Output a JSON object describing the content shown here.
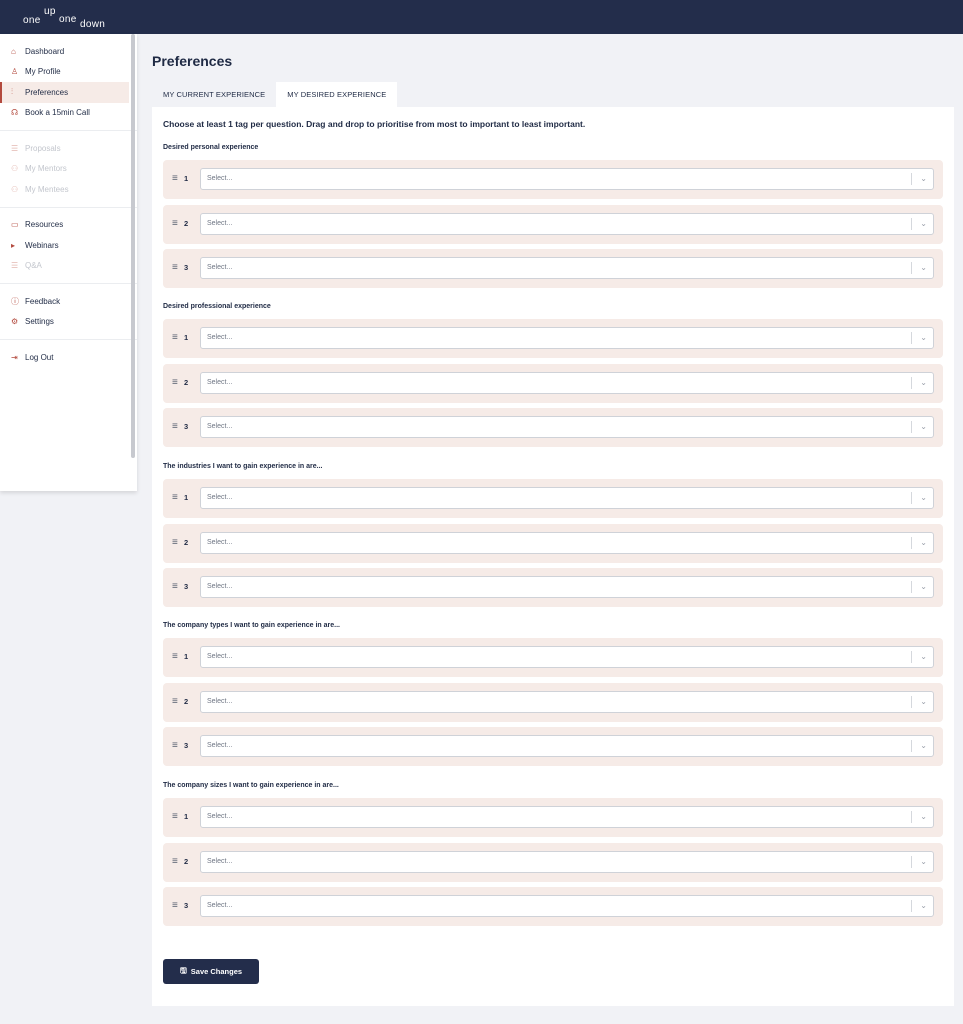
{
  "brand": {
    "w1": "one",
    "w2": "up",
    "w3": "one",
    "w4": "down"
  },
  "sidebar": {
    "groups": [
      [
        {
          "label": "Dashboard",
          "icon": "⌂",
          "state": "normal"
        },
        {
          "label": "My Profile",
          "icon": "♙",
          "state": "normal"
        },
        {
          "label": "Preferences",
          "icon": "⫶",
          "state": "active"
        },
        {
          "label": "Book a 15min Call",
          "icon": "☊",
          "state": "normal"
        }
      ],
      [
        {
          "label": "Proposals",
          "icon": "☰",
          "state": "disabled"
        },
        {
          "label": "My Mentors",
          "icon": "⚇",
          "state": "disabled"
        },
        {
          "label": "My Mentees",
          "icon": "⚇",
          "state": "disabled"
        }
      ],
      [
        {
          "label": "Resources",
          "icon": "▭",
          "state": "normal"
        },
        {
          "label": "Webinars",
          "icon": "▸",
          "state": "normal"
        },
        {
          "label": "Q&A",
          "icon": "☰",
          "state": "disabled"
        }
      ],
      [
        {
          "label": "Feedback",
          "icon": "ⓘ",
          "state": "normal"
        },
        {
          "label": "Settings",
          "icon": "⚙",
          "state": "normal"
        }
      ],
      [
        {
          "label": "Log Out",
          "icon": "⇥",
          "state": "normal"
        }
      ]
    ]
  },
  "main": {
    "title": "Preferences",
    "tabs": [
      {
        "label": "MY CURRENT EXPERIENCE",
        "active": false
      },
      {
        "label": "MY DESIRED EXPERIENCE",
        "active": true
      }
    ],
    "intro": "Choose at least 1 tag per question. Drag and drop to prioritise from most to important to least important.",
    "placeholder": "Select...",
    "sections": [
      {
        "label": "Desired personal experience",
        "ranks": [
          "1",
          "2",
          "3"
        ]
      },
      {
        "label": "Desired professional experience",
        "ranks": [
          "1",
          "2",
          "3"
        ]
      },
      {
        "label": "The industries I want to gain experience in are...",
        "ranks": [
          "1",
          "2",
          "3"
        ]
      },
      {
        "label": "The company types I want to gain experience in are...",
        "ranks": [
          "1",
          "2",
          "3"
        ]
      },
      {
        "label": "The company sizes I want to gain experience in are...",
        "ranks": [
          "1",
          "2",
          "3"
        ]
      }
    ],
    "save_label": "Save Changes"
  }
}
